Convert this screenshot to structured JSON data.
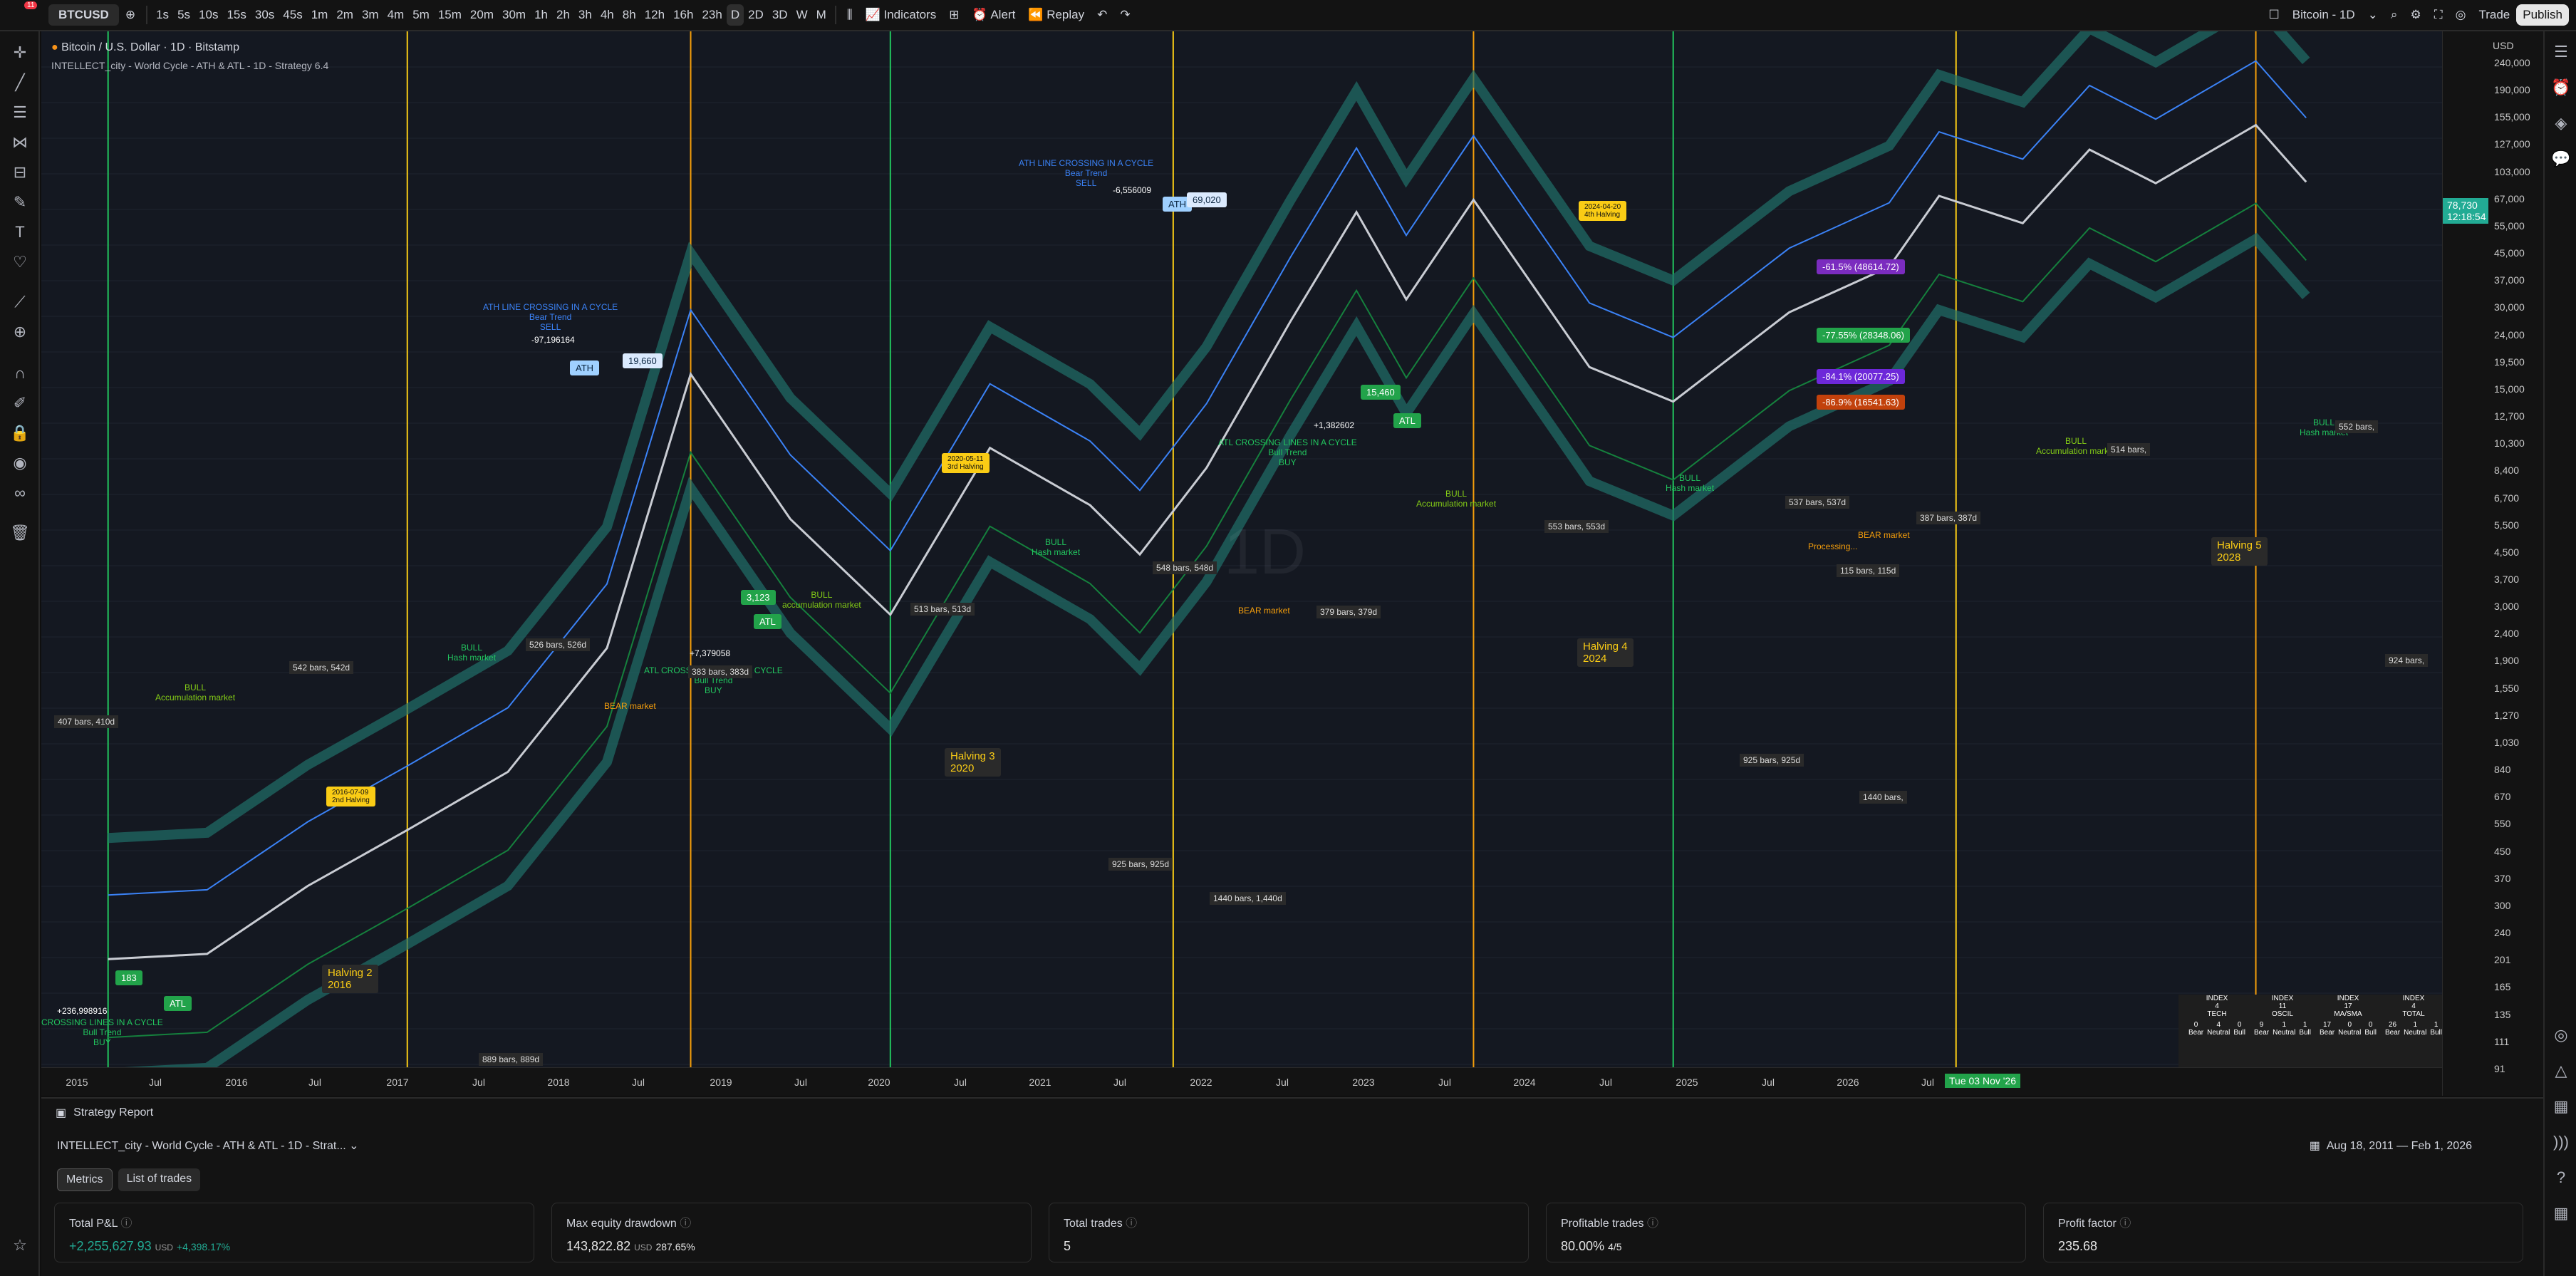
{
  "topbar": {
    "symbol": "BTCUSD",
    "badge": "11",
    "intervals": [
      "1s",
      "5s",
      "10s",
      "15s",
      "30s",
      "45s",
      "1m",
      "2m",
      "3m",
      "4m",
      "5m",
      "15m",
      "20m",
      "30m",
      "1h",
      "2h",
      "3h",
      "4h",
      "8h",
      "12h",
      "16h",
      "23h",
      "D",
      "2D",
      "3D",
      "W",
      "M"
    ],
    "selected_interval": "D",
    "indicators": "Indicators",
    "alert": "Alert",
    "replay": "Replay",
    "layout_title": "Bitcoin - 1D",
    "trade": "Trade",
    "publish": "Publish"
  },
  "legend": {
    "title": "Bitcoin / U.S. Dollar · 1D · Bitstamp",
    "strategy": "INTELLECT_city - World Cycle - ATH & ATL - 1D - Strategy 6.4"
  },
  "watermark": "1D",
  "price_axis": {
    "currency": "USD",
    "current_price": "78,730",
    "countdown": "12:18:54",
    "ticks": [
      "240,000",
      "190,000",
      "155,000",
      "127,000",
      "103,000",
      "67,000",
      "55,000",
      "45,000",
      "37,000",
      "30,000",
      "24,000",
      "19,500",
      "15,000",
      "12,700",
      "10,300",
      "8,400",
      "6,700",
      "5,500",
      "4,500",
      "3,700",
      "3,000",
      "2,400",
      "1,900",
      "1,550",
      "1,270",
      "1,030",
      "840",
      "670",
      "550",
      "450",
      "370",
      "300",
      "240",
      "201",
      "165",
      "135",
      "111",
      "91"
    ]
  },
  "time_axis": {
    "ticks": [
      "2015",
      "Jul",
      "2016",
      "Jul",
      "2017",
      "Jul",
      "2018",
      "Jul",
      "2019",
      "Jul",
      "2020",
      "Jul",
      "2021",
      "Jul",
      "2022",
      "Jul",
      "2023",
      "Jul",
      "2024",
      "Jul",
      "2025",
      "Jul",
      "2026",
      "Jul"
    ],
    "cursor_date": "Tue 03 Nov '26"
  },
  "annotations": {
    "ath1": "ATH",
    "ath1_val": "19,660",
    "ath2": "ATH",
    "ath2_val": "69,020",
    "atl1": "ATL",
    "atl2": "ATL",
    "atl3": "ATL",
    "atl_val1": "183",
    "atl_val2": "3,123",
    "atl_val3": "15,460",
    "halving2": "Halving 2\n2016",
    "halving3": "Halving 3\n2020",
    "halving4": "Halving 4\n2024",
    "halving5": "Halving 5\n2028",
    "bull1": "BULL\nAccumulation market",
    "bull2": "BULL\nHash market",
    "bear1": "BEAR market",
    "bull3": "BULL\naccumulation market",
    "bull4": "BULL\nHash market",
    "bear2": "BEAR market",
    "bull5": "BULL\nAccumulation market",
    "bull6": "BULL\nHash market",
    "bear3": "BEAR market",
    "bull7": "BULL\nAccumulation market",
    "bull8": "BULL\nHash market",
    "processing": "Processing...",
    "ath_cross1": "ATH LINE CROSSING IN A CYCLE\nBear Trend\nSELL",
    "ath_cross2": "ATH LINE CROSSING IN A CYCLE\nBear Trend\nSELL",
    "atl_cross1": "ATL CROSSING LINES IN A CYCLE\nBull Trend\nBUY",
    "atl_cross2": "ATL CROSSING LINES IN A CYCLE\nBull Trend\nBUY",
    "atl_cross0": "CROSSING LINES IN A CYCLE\nBull Trend\nBUY",
    "pct1": "-97,196164",
    "pct2": "+7,379058",
    "pct3": "-6,556009",
    "pct4": "+1,382602",
    "pct5": "+236,998916",
    "tag1": "-61.5% (48614.72)",
    "tag2": "-77.55% (28348.06)",
    "tag3": "-84.1% (20077.25)",
    "tag4": "-86.9% (16541.63)",
    "date1": "2016-07-09\n2nd Halving",
    "date2": "2020-05-11\n3rd Halving",
    "date3": "2024-04-20\n4th Halving",
    "bars": [
      "407 bars, 410d",
      "542 bars, 542d",
      "526 bars, 526d",
      "383 bars, 383d",
      "548 bars, 548d",
      "513 bars, 513d",
      "379 bars, 379d",
      "925 bars, 925d",
      "1440 bars, 1,440d",
      "889 bars, 889d",
      "553 bars, 553d",
      "537 bars, 537d",
      "387 bars, 387d",
      "115 bars, 115d",
      "514 bars,",
      "552 bars,",
      "924 bars,",
      "925 bars, 925d",
      "1440 bars,"
    ]
  },
  "index_table": {
    "headers": [
      "INDEX\n4\nTECH",
      "INDEX\n11\nOSCIL",
      "INDEX\n17\nMA/SMA",
      "INDEX\n4\nTOTAL"
    ],
    "values": [
      [
        "0",
        "4",
        "0"
      ],
      [
        "9",
        "1",
        "1"
      ],
      [
        "17",
        "0",
        "0"
      ],
      [
        "26",
        "1",
        "1"
      ]
    ],
    "labels": [
      "Bear",
      "Neutral",
      "Bull"
    ]
  },
  "report": {
    "title": "Strategy Report",
    "strategy": "INTELLECT_city - World Cycle - ATH & ATL - 1D - Strat...",
    "date_range": "Aug 18, 2011 — Feb 1, 2026",
    "tabs": [
      "Metrics",
      "List of trades"
    ],
    "cards": [
      {
        "title": "Total P&L",
        "value": "+2,255,627.93",
        "unit": "USD",
        "sub": "+4,398.17%"
      },
      {
        "title": "Max equity drawdown",
        "value": "143,822.82",
        "unit": "USD",
        "sub": "287.65%"
      },
      {
        "title": "Total trades",
        "value": "5",
        "unit": "",
        "sub": ""
      },
      {
        "title": "Profitable trades",
        "value": "80.00%",
        "unit": "",
        "sub": "4/5"
      },
      {
        "title": "Profit factor",
        "value": "235.68",
        "unit": "",
        "sub": ""
      }
    ]
  },
  "colors": {
    "bull": "#22c55e",
    "bear": "#f59e0b",
    "halving": "#facc15",
    "band": "#1f6f6a",
    "ath": "#3b82f6",
    "tag1": "#7b2cbf",
    "tag2": "#22a34a",
    "tag3": "#6d28d9",
    "tag4": "#c2410c"
  },
  "chart_data": {
    "type": "line",
    "title": "Bitcoin / U.S. Dollar · 1D · Bitstamp",
    "x": [
      "2015-01",
      "2015-07",
      "2016-01",
      "2016-07",
      "2017-01",
      "2017-07",
      "2017-12",
      "2018-06",
      "2018-12",
      "2019-06",
      "2019-12",
      "2020-03",
      "2020-07",
      "2020-12",
      "2021-04",
      "2021-07",
      "2021-11",
      "2022-06",
      "2022-11",
      "2023-06",
      "2023-12",
      "2024-03",
      "2024-08",
      "2024-12",
      "2025-04",
      "2025-10",
      "2026-01"
    ],
    "series": [
      {
        "values": [
          250,
          260,
          430,
          650,
          1000,
          2500,
          19000,
          6500,
          3200,
          11000,
          7200,
          5000,
          9500,
          28000,
          63000,
          33000,
          69000,
          20000,
          15500,
          30000,
          42000,
          71000,
          58000,
          100000,
          78000,
          120000,
          78730
        ]
      }
    ],
    "y_scale": "log",
    "ylim": [
      91,
      240000
    ]
  }
}
